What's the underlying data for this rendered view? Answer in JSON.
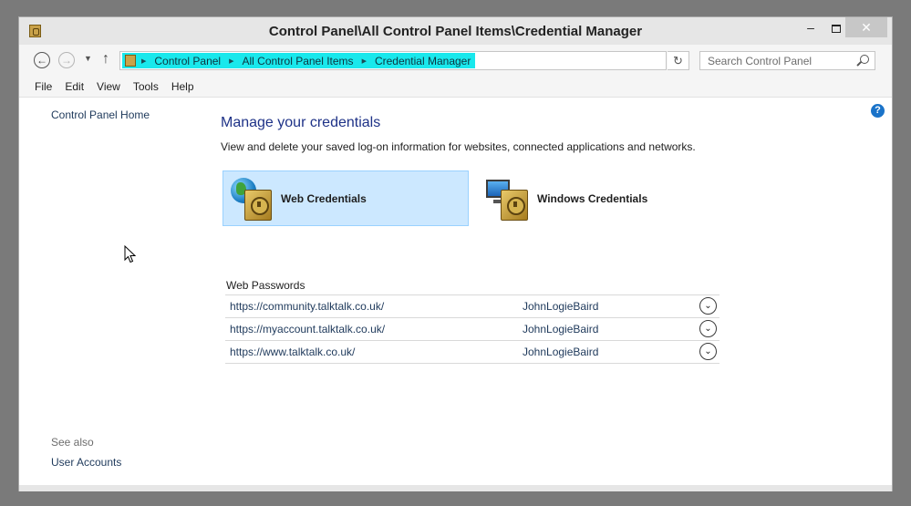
{
  "window": {
    "title": "Control Panel\\All Control Panel Items\\Credential Manager",
    "controls": {
      "minimize": "–",
      "close": "✕"
    }
  },
  "address": {
    "breadcrumbs": [
      "Control Panel",
      "All Control Panel Items",
      "Credential Manager"
    ],
    "search_placeholder": "Search Control Panel",
    "highlight_color": "#19e8ec"
  },
  "menu": [
    "File",
    "Edit",
    "View",
    "Tools",
    "Help"
  ],
  "sidebar": {
    "home_link": "Control Panel Home",
    "see_also_label": "See also",
    "see_also_links": [
      "User Accounts"
    ]
  },
  "main": {
    "title": "Manage your credentials",
    "description": "View and delete your saved log-on information for websites, connected applications and networks.",
    "tiles": [
      {
        "label": "Web Credentials",
        "icon": "globe-vault-icon",
        "selected": true
      },
      {
        "label": "Windows Credentials",
        "icon": "monitor-vault-icon",
        "selected": false
      }
    ],
    "section_heading": "Web Passwords",
    "passwords": [
      {
        "url": "https://community.talktalk.co.uk/",
        "user": "JohnLogieBaird"
      },
      {
        "url": "https://myaccount.talktalk.co.uk/",
        "user": "JohnLogieBaird"
      },
      {
        "url": "https://www.talktalk.co.uk/",
        "user": "JohnLogieBaird"
      }
    ]
  },
  "icons": {
    "help": "?",
    "expand": "⌄",
    "back": "←",
    "forward": "→",
    "up": "↑",
    "refresh": "↻"
  }
}
